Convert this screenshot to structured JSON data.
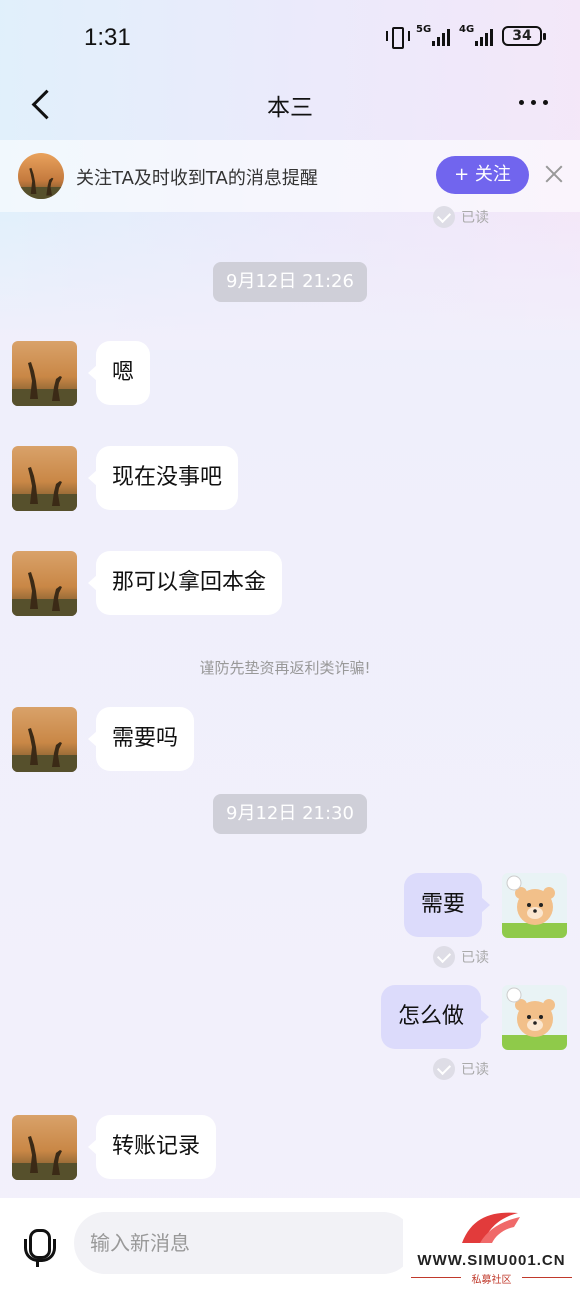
{
  "status_bar": {
    "time": "1:31",
    "net1": "5G",
    "net2": "4G",
    "battery": "34"
  },
  "nav": {
    "title": "本三"
  },
  "banner": {
    "text": "关注TA及时收到TA的消息提醒",
    "follow_label": "+ 关注"
  },
  "read_label": "已读",
  "timestamps": [
    "9月12日 21:26",
    "9月12日 21:30"
  ],
  "notice": "谨防先垫资再返利类诈骗!",
  "messages": [
    {
      "side": "left",
      "text": "嗯"
    },
    {
      "side": "left",
      "text": "现在没事吧"
    },
    {
      "side": "left",
      "text": "那可以拿回本金"
    },
    {
      "side": "left",
      "text": "需要吗"
    },
    {
      "side": "right",
      "text": "需要",
      "read": "已读"
    },
    {
      "side": "right",
      "text": "怎么做",
      "read": "已读"
    },
    {
      "side": "left",
      "text": "转账记录"
    }
  ],
  "input": {
    "placeholder": "输入新消息"
  },
  "watermark": {
    "site": "WWW.SIMU001.CN",
    "sub": "私募社区"
  },
  "colors": {
    "accent": "#7165ee",
    "bubble_self": "#dcdbfb",
    "bubble_other": "#ffffff"
  }
}
